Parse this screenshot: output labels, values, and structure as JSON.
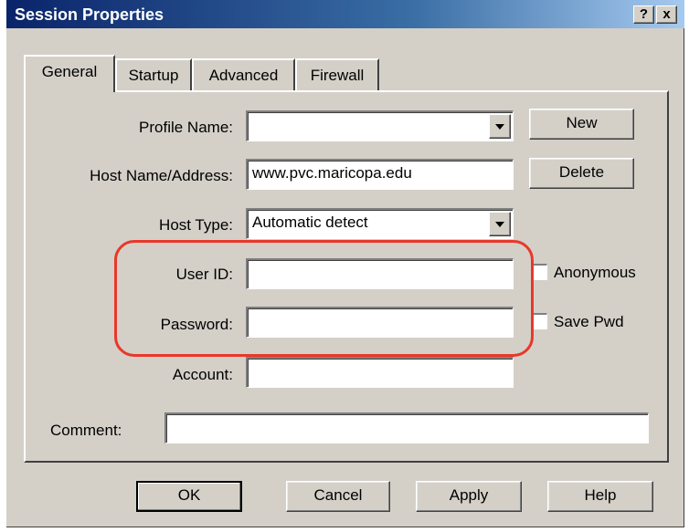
{
  "window": {
    "title": "Session Properties",
    "help_glyph": "?",
    "close_glyph": "x"
  },
  "tabs": [
    {
      "label": "General"
    },
    {
      "label": "Startup"
    },
    {
      "label": "Advanced"
    },
    {
      "label": "Firewall"
    }
  ],
  "fields": {
    "profile_name": {
      "label": "Profile Name:",
      "value": ""
    },
    "host_name": {
      "label": "Host Name/Address:",
      "value": "www.pvc.maricopa.edu"
    },
    "host_type": {
      "label": "Host Type:",
      "value": "Automatic detect"
    },
    "user_id": {
      "label": "User ID:",
      "value": ""
    },
    "password": {
      "label": "Password:",
      "value": ""
    },
    "account": {
      "label": "Account:",
      "value": ""
    },
    "comment": {
      "label": "Comment:",
      "value": ""
    }
  },
  "checkboxes": {
    "anonymous": {
      "label": "Anonymous",
      "checked": false
    },
    "save_pwd": {
      "label": "Save Pwd",
      "checked": false
    }
  },
  "side_buttons": {
    "new": "New",
    "delete": "Delete"
  },
  "footer_buttons": {
    "ok": "OK",
    "cancel": "Cancel",
    "apply": "Apply",
    "help": "Help"
  },
  "highlight_color": "#e8382a"
}
